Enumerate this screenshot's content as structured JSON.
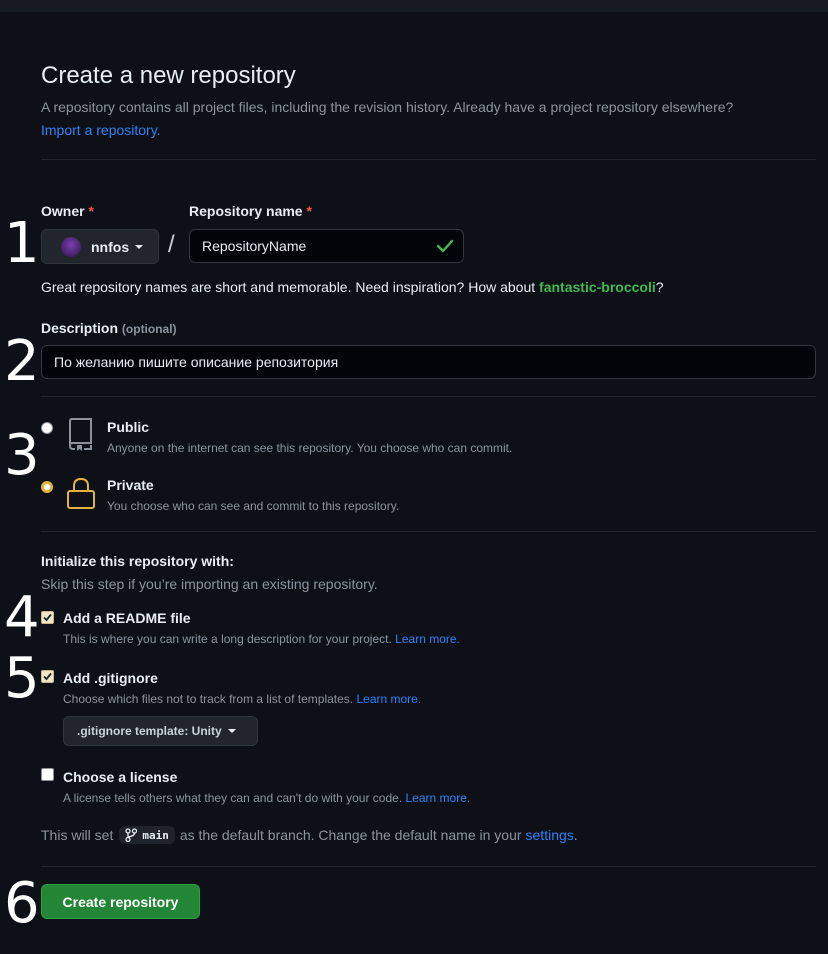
{
  "header": {
    "title": "Create a new repository",
    "subtitle": "A repository contains all project files, including the revision history. Already have a project repository elsewhere?",
    "import_link": "Import a repository."
  },
  "owner": {
    "label": "Owner",
    "required_mark": "*",
    "value": "nnfos"
  },
  "repo_name": {
    "label": "Repository name",
    "required_mark": "*",
    "value": "RepositoryName",
    "slash": "/"
  },
  "name_hint": {
    "text": "Great repository names are short and memorable. Need inspiration? How about",
    "suggestion": "fantastic-broccoli",
    "end": "?"
  },
  "description": {
    "label": "Description",
    "optional": "(optional)",
    "value": "По желанию пишите описание репозитория"
  },
  "visibility": {
    "public": {
      "title": "Public",
      "desc": "Anyone on the internet can see this repository. You choose who can commit.",
      "selected": false
    },
    "private": {
      "title": "Private",
      "desc": "You choose who can see and commit to this repository.",
      "selected": true
    }
  },
  "init": {
    "title": "Initialize this repository with:",
    "subtitle": "Skip this step if you’re importing an existing repository.",
    "readme": {
      "label": "Add a README file",
      "desc": "This is where you can write a long description for your project.",
      "link": "Learn more.",
      "checked": true
    },
    "gitignore": {
      "label": "Add .gitignore",
      "desc": "Choose which files not to track from a list of templates.",
      "link": "Learn more.",
      "checked": true,
      "template_label": ".gitignore template: Unity"
    },
    "license": {
      "label": "Choose a license",
      "desc": "A license tells others what they can and can't do with your code.",
      "link": "Learn more.",
      "checked": false
    }
  },
  "branch_note": {
    "prefix": "This will set",
    "branch": "main",
    "middle": "as the default branch. Change the default name in your",
    "link": "settings",
    "end": "."
  },
  "create_button": "Create repository",
  "annotations": [
    "1",
    "2",
    "3",
    "4",
    "5",
    "6"
  ],
  "colors": {
    "accent_link": "#2f81f7",
    "success_green": "#238636",
    "suggestion_green": "#3fb950",
    "background": "#0d1117"
  }
}
